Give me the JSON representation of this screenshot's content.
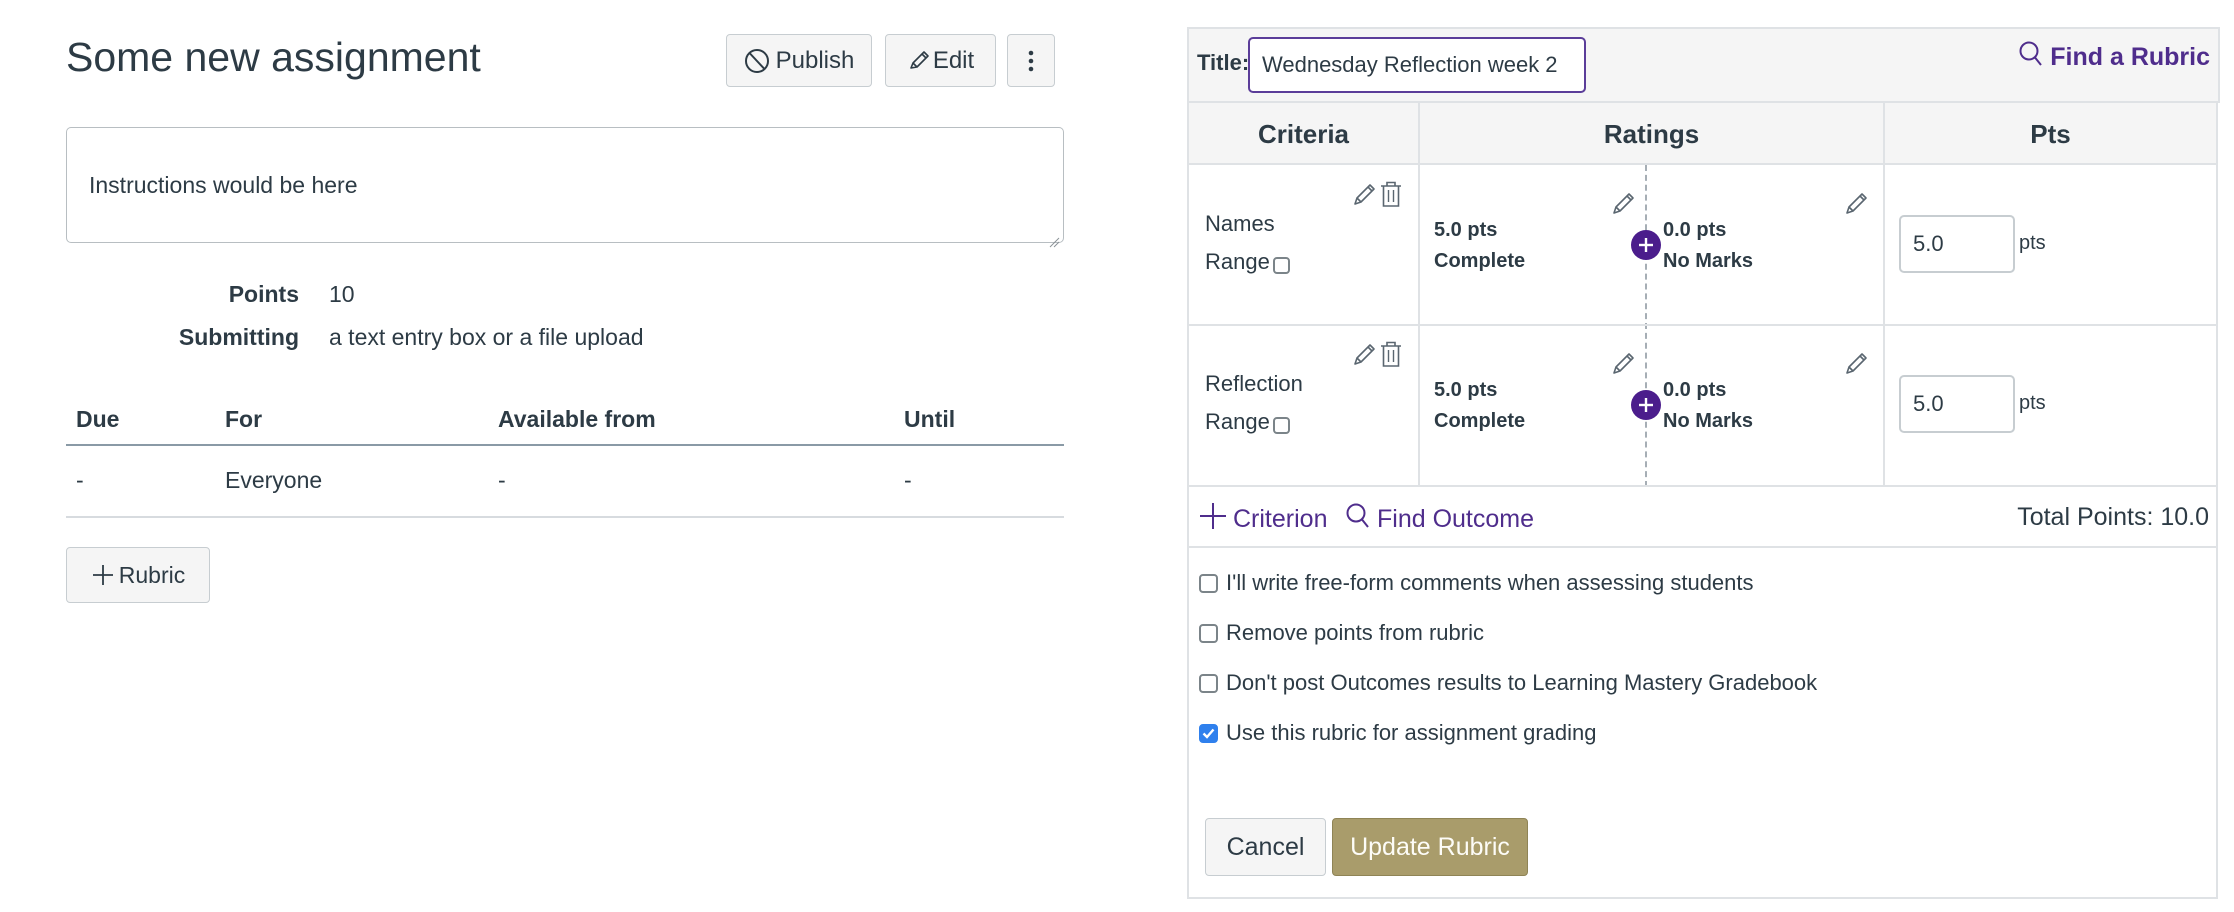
{
  "assignment": {
    "title": "Some new assignment",
    "toolbar": {
      "publish_label": "Publish",
      "edit_label": "Edit",
      "publish_icon": "unpublished-circle-icon",
      "edit_icon": "pencil-icon",
      "more_icon": "kebab-menu-icon"
    },
    "instructions": "Instructions would be here",
    "details": [
      {
        "label": "Points",
        "value": "10"
      },
      {
        "label": "Submitting",
        "value": "a text entry box or a file upload"
      }
    ],
    "dates_table": {
      "headers": [
        "Due",
        "For",
        "Available from",
        "Until"
      ],
      "rows": [
        [
          "-",
          "Everyone",
          "-",
          "-"
        ]
      ]
    },
    "add_rubric_label": "Rubric"
  },
  "rubric": {
    "title_label": "Title:",
    "title_value": "Wednesday Reflection week 2",
    "find_rubric_label": "Find a Rubric",
    "headers": {
      "criteria": "Criteria",
      "ratings": "Ratings",
      "pts": "Pts"
    },
    "criteria": [
      {
        "name": "Names",
        "range_label": "Range",
        "range_checked": false,
        "ratings": [
          {
            "points": "5.0 pts",
            "description": "Complete"
          },
          {
            "points": "0.0 pts",
            "description": "No Marks"
          }
        ],
        "points_value": "5.0",
        "points_unit": "pts"
      },
      {
        "name": "Reflection",
        "range_label": "Range",
        "range_checked": false,
        "ratings": [
          {
            "points": "5.0 pts",
            "description": "Complete"
          },
          {
            "points": "0.0 pts",
            "description": "No Marks"
          }
        ],
        "points_value": "5.0",
        "points_unit": "pts"
      }
    ],
    "add_criterion_label": "Criterion",
    "find_outcome_label": "Find Outcome",
    "total_points": "Total Points: 10.0",
    "options": [
      {
        "label": "I'll write free-form comments when assessing students",
        "checked": false
      },
      {
        "label": "Remove points from rubric",
        "checked": false
      },
      {
        "label": "Don't post Outcomes results to Learning Mastery Gradebook",
        "checked": false
      },
      {
        "label": "Use this rubric for assignment grading",
        "checked": true
      }
    ],
    "cancel_label": "Cancel",
    "update_label": "Update Rubric"
  },
  "colors": {
    "link_purple": "#4f2d8c",
    "add_rating_purple": "#4b1d8c",
    "update_button_gold": "#a99c6b",
    "checkbox_checked_blue": "#2f80ed",
    "text_dark": "#2d3b45"
  }
}
